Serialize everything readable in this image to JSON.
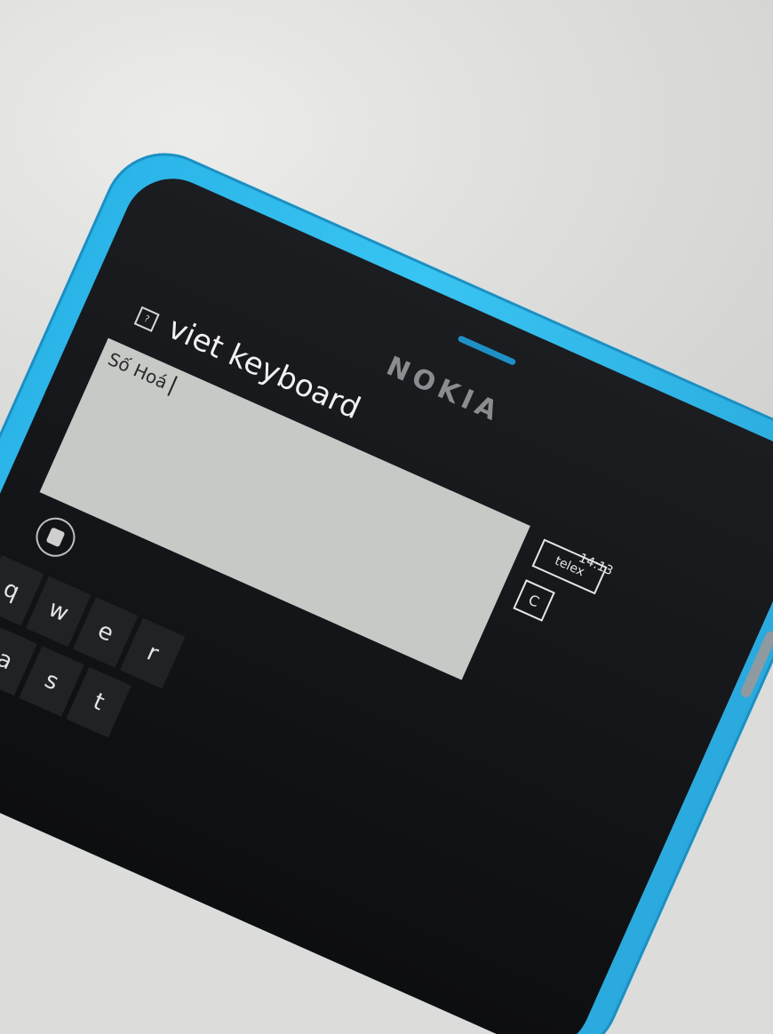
{
  "phone": {
    "brand": "NOKIA",
    "app_title": "viet keyboard",
    "app_icon_glyph": "?",
    "text_value": "Số Hoá",
    "telex_label": "telex",
    "c_label": "C",
    "time": "14:13"
  },
  "keyboard": {
    "row1": [
      "q",
      "w",
      "e",
      "r"
    ],
    "row2": [
      "a",
      "s",
      "t"
    ]
  },
  "colors": {
    "phone_body": "#2ab4e8",
    "screen": "#0d0e10",
    "text_area": "#c6c9c6",
    "background": "#dcdcda"
  }
}
